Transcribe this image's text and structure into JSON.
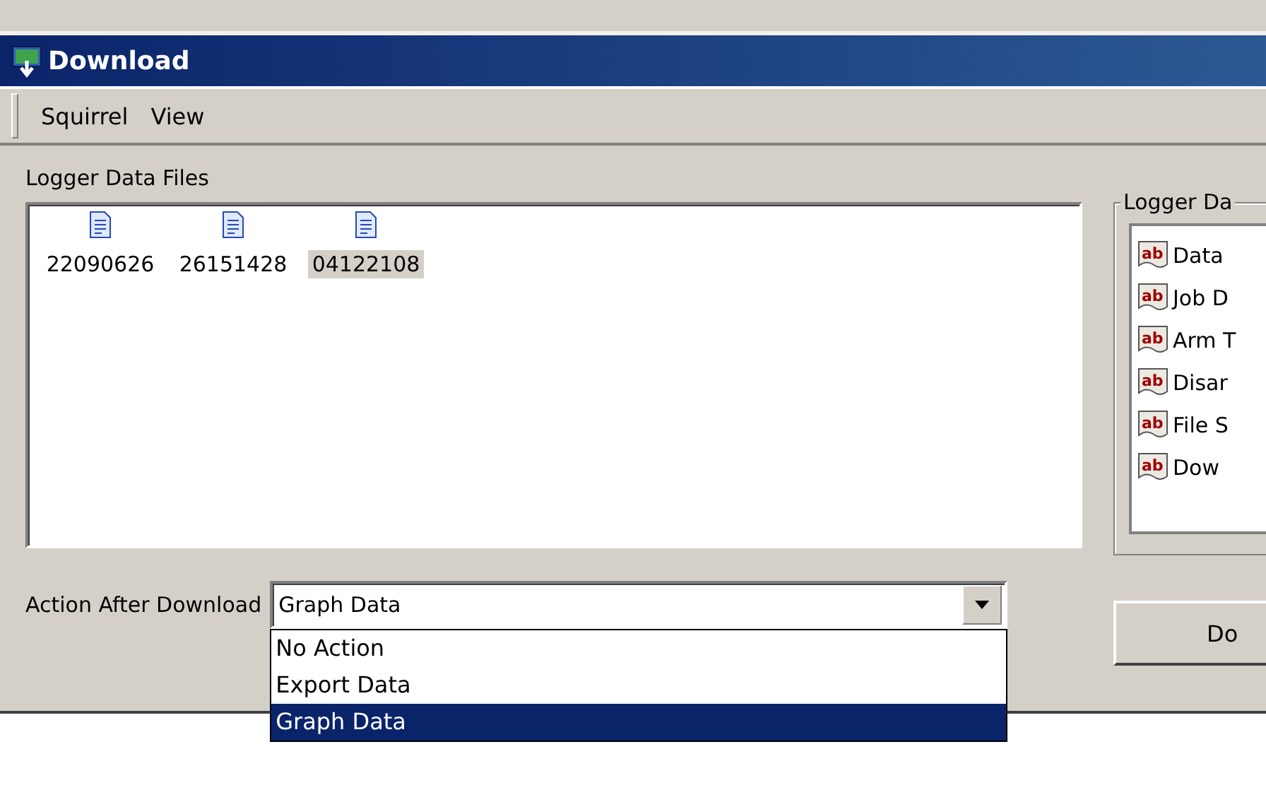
{
  "window": {
    "title": "Download"
  },
  "menu": [
    "Squirrel",
    "View"
  ],
  "files": {
    "label": "Logger Data Files",
    "items": [
      {
        "name": "22090626",
        "selected": false
      },
      {
        "name": "26151428",
        "selected": false
      },
      {
        "name": "04122108",
        "selected": true
      }
    ]
  },
  "action": {
    "label": "Action After Download",
    "value": "Graph Data",
    "expanded": true,
    "options": [
      {
        "label": "No Action",
        "selected": false
      },
      {
        "label": "Export Data",
        "selected": false
      },
      {
        "label": "Graph Data",
        "selected": true
      }
    ]
  },
  "logger_data": {
    "title": "Logger Da",
    "items": [
      {
        "icon_text": "ab",
        "label": "Data"
      },
      {
        "icon_text": "ab",
        "label": "Job D"
      },
      {
        "icon_text": "ab",
        "label": "Arm T"
      },
      {
        "icon_text": "ab",
        "label": "Disar"
      },
      {
        "icon_text": "ab",
        "label": "File S"
      },
      {
        "icon_text": "ab",
        "label": "Dow"
      }
    ]
  },
  "button": "Do"
}
